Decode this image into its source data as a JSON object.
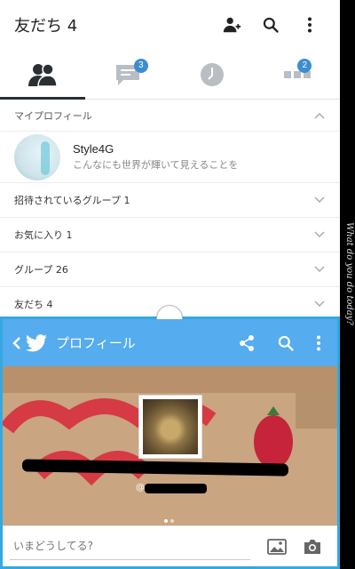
{
  "line": {
    "header": {
      "title": "友だち 4"
    },
    "tabs": [
      {
        "name": "friends",
        "badge": ""
      },
      {
        "name": "chats",
        "badge": "3"
      },
      {
        "name": "timeline",
        "badge": ""
      },
      {
        "name": "more",
        "badge": "2"
      }
    ],
    "my_profile": {
      "section_label": "マイプロフィール",
      "name": "Style4G",
      "status": "こんなにも世界が輝いて見えることを"
    },
    "rows": [
      {
        "label": "招待されているグループ 1"
      },
      {
        "label": "お気に入り 1"
      },
      {
        "label": "グループ 26"
      },
      {
        "label": "友だち 4"
      }
    ]
  },
  "side_text": "What do you do today?",
  "twitter": {
    "header": {
      "title": "プロフィール"
    },
    "handle": "@",
    "compose_placeholder": "いまどうしてる?"
  },
  "colors": {
    "twitter_blue": "#55acee",
    "split_accent": "#33a9e0",
    "badge_blue": "#3b8ed0"
  }
}
